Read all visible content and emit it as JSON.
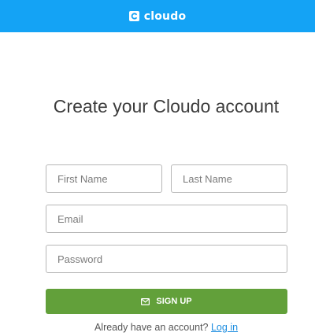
{
  "header": {
    "brand_name": "cloudo",
    "logo_letter": "c",
    "brand_color": "#14a3f5"
  },
  "main": {
    "title": "Create your Cloudo account"
  },
  "form": {
    "first_name_placeholder": "First Name",
    "last_name_placeholder": "Last Name",
    "email_placeholder": "Email",
    "password_placeholder": "Password",
    "submit_label": "SIGN UP",
    "submit_icon": "envelope-icon",
    "submit_color": "#62a03a"
  },
  "footer": {
    "prompt": "Already have an account?",
    "login_link": "Log in"
  }
}
